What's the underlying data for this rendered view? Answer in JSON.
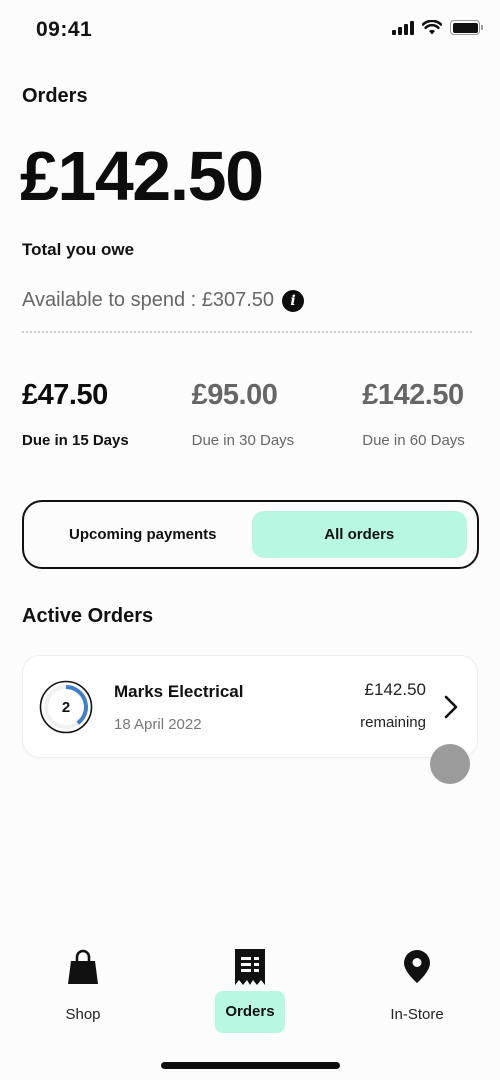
{
  "status_bar": {
    "time": "09:41",
    "icons": [
      "cellular-signal-icon",
      "wifi-icon",
      "battery-icon"
    ]
  },
  "header": {
    "title": "Orders",
    "total_amount": "£142.50",
    "total_label": "Total you owe",
    "available_text": "Available to spend : £307.50",
    "info_icon": "info-icon"
  },
  "due": [
    {
      "amount": "£47.50",
      "label": "Due in 15 Days",
      "active": true
    },
    {
      "amount": "£95.00",
      "label": "Due in 30 Days",
      "active": false
    },
    {
      "amount": "£142.50",
      "label": "Due in 60 Days",
      "active": false
    }
  ],
  "segmented": {
    "options": [
      "Upcoming payments",
      "All orders"
    ],
    "selected": "All orders"
  },
  "active_orders": {
    "title": "Active Orders",
    "orders": [
      {
        "installment_number": "2",
        "progress_fraction": 0.4,
        "merchant": "Marks Electrical",
        "date": "18 April 2022",
        "amount": "£142.50",
        "amount_label": "remaining"
      }
    ]
  },
  "bottom_nav": {
    "items": [
      {
        "label": "Shop",
        "icon": "shopping-bag-icon"
      },
      {
        "label": "Orders",
        "icon": "receipt-icon",
        "active": true
      },
      {
        "label": "In-Store",
        "icon": "location-pin-icon"
      }
    ]
  },
  "colors": {
    "accent": "#b8f7e2",
    "progress": "#3f7fcf",
    "text_primary": "#111111",
    "text_muted": "#666666"
  }
}
